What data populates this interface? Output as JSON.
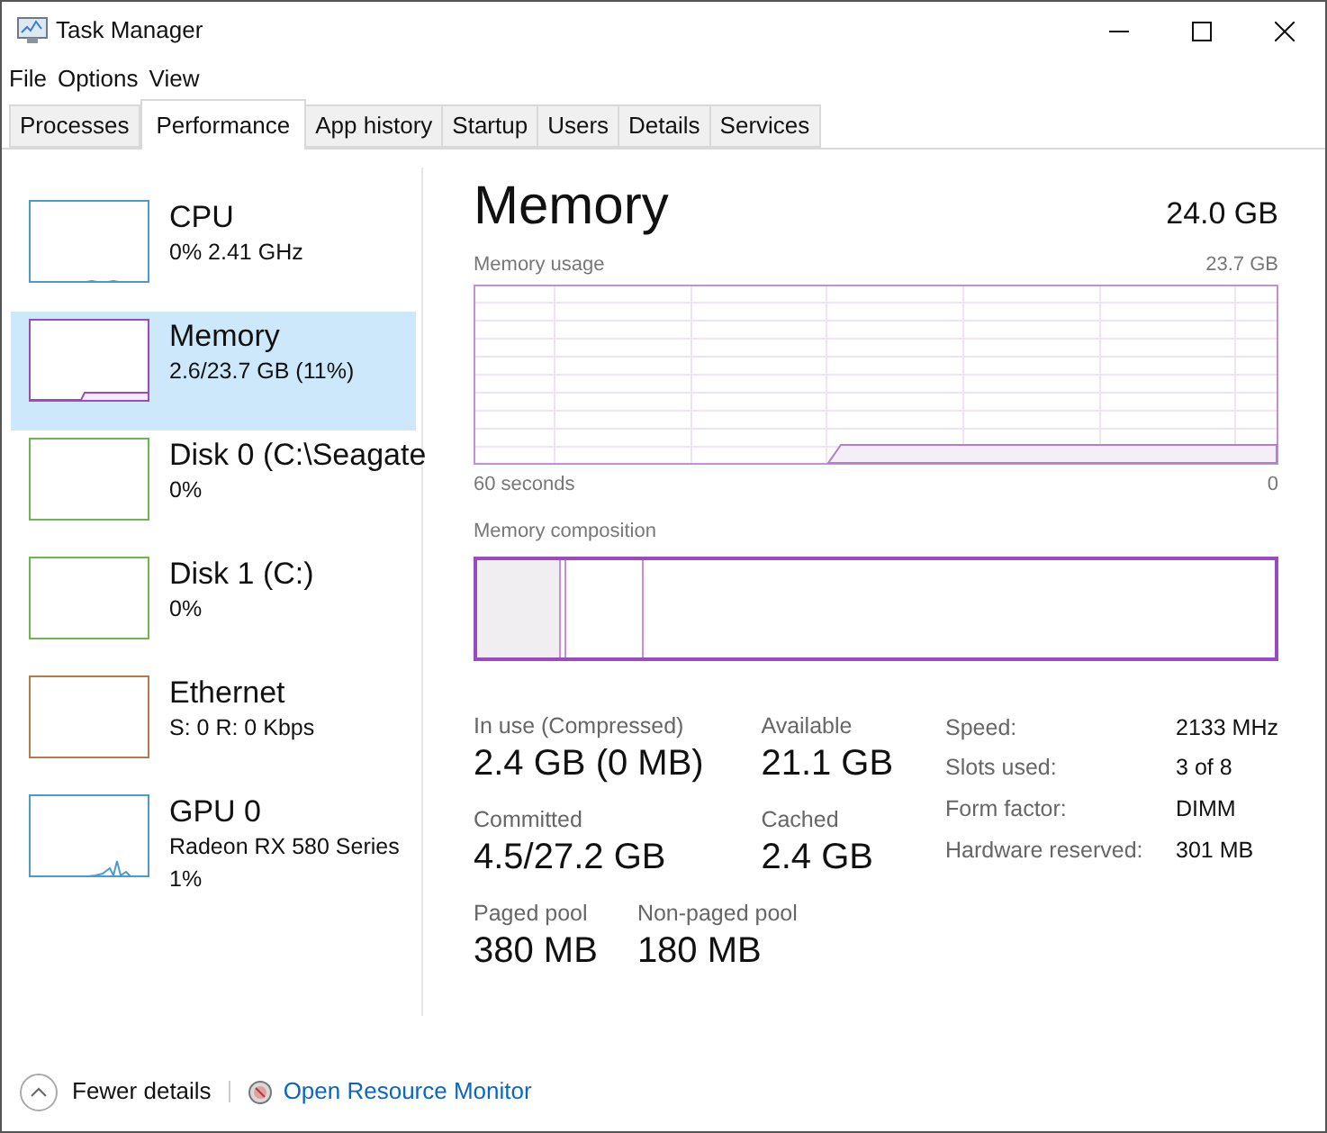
{
  "window": {
    "title": "Task Manager"
  },
  "menu": [
    "File",
    "Options",
    "View"
  ],
  "tabs": [
    {
      "label": "Processes",
      "selected": false
    },
    {
      "label": "Performance",
      "selected": true
    },
    {
      "label": "App history",
      "selected": false
    },
    {
      "label": "Startup",
      "selected": false
    },
    {
      "label": "Users",
      "selected": false
    },
    {
      "label": "Details",
      "selected": false
    },
    {
      "label": "Services",
      "selected": false
    }
  ],
  "sidebar": {
    "items": [
      {
        "name": "CPU",
        "lines": [
          "0% 2.41 GHz"
        ],
        "color": "#4a9ccf",
        "selected": false
      },
      {
        "name": "Memory",
        "lines": [
          "2.6/23.7 GB (11%)"
        ],
        "color": "#9b4bc0",
        "selected": true
      },
      {
        "name": "Disk 0 (C:\\Seagate",
        "lines": [
          "0%"
        ],
        "color": "#6cb650",
        "selected": false
      },
      {
        "name": "Disk 1 (C:)",
        "lines": [
          "0%"
        ],
        "color": "#6cb650",
        "selected": false
      },
      {
        "name": "Ethernet",
        "lines": [
          "S: 0 R: 0 Kbps"
        ],
        "color": "#b97a4a",
        "selected": false
      },
      {
        "name": "GPU 0",
        "lines": [
          "Radeon RX 580 Series",
          "1%"
        ],
        "color": "#4a9ccf",
        "selected": false
      }
    ]
  },
  "detail": {
    "title": "Memory",
    "total": "24.0 GB",
    "usage_label": "Memory usage",
    "usage_max": "23.7 GB",
    "time_label": "60 seconds",
    "time_end": "0",
    "composition_label": "Memory composition",
    "stats": [
      {
        "label": "In use (Compressed)",
        "value": "2.4 GB (0 MB)"
      },
      {
        "label": "Available",
        "value": "21.1 GB"
      },
      {
        "label": "Committed",
        "value": "4.5/27.2 GB"
      },
      {
        "label": "Cached",
        "value": "2.4 GB"
      },
      {
        "label": "Paged pool",
        "value": "380 MB"
      },
      {
        "label": "Non-paged pool",
        "value": "180 MB"
      }
    ],
    "specs": [
      {
        "label": "Speed:",
        "value": "2133 MHz"
      },
      {
        "label": "Slots used:",
        "value": "3 of 8"
      },
      {
        "label": "Form factor:",
        "value": "DIMM"
      },
      {
        "label": "Hardware reserved:",
        "value": "301 MB"
      }
    ]
  },
  "footer": {
    "fewer": "Fewer details",
    "link": "Open Resource Monitor"
  }
}
